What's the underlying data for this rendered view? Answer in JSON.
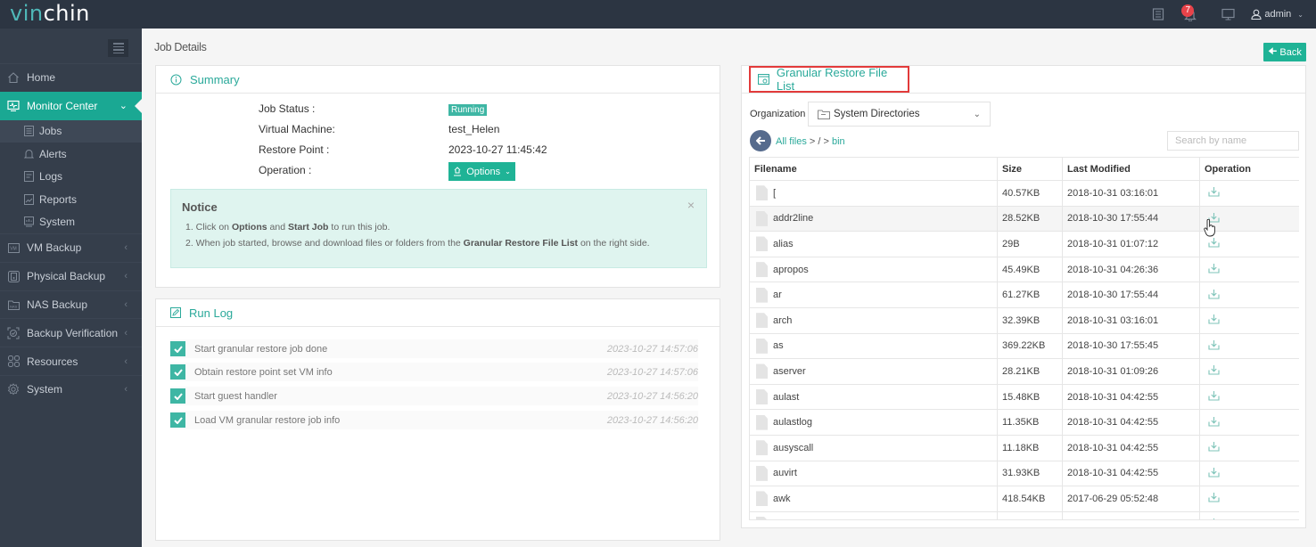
{
  "brand": {
    "part1": "vin",
    "part2": "chin"
  },
  "topbar": {
    "notification_count": "7",
    "user": "admin",
    "icons": [
      "task-list-icon",
      "bell-icon",
      "monitor-icon",
      "user-icon"
    ]
  },
  "sidebar": {
    "items": [
      {
        "label": "Home",
        "icon": "home-icon",
        "active": false
      },
      {
        "label": "Monitor Center",
        "icon": "monitor-center-icon",
        "active": true,
        "expanded": true
      },
      {
        "label": "VM Backup",
        "icon": "vm-icon"
      },
      {
        "label": "Physical Backup",
        "icon": "physical-icon"
      },
      {
        "label": "NAS Backup",
        "icon": "nas-icon"
      },
      {
        "label": "Backup Verification",
        "icon": "verification-icon"
      },
      {
        "label": "Resources",
        "icon": "resources-icon"
      },
      {
        "label": "System",
        "icon": "gear-icon"
      }
    ],
    "sub_items": [
      {
        "label": "Jobs",
        "active": true
      },
      {
        "label": "Alerts"
      },
      {
        "label": "Logs"
      },
      {
        "label": "Reports"
      },
      {
        "label": "System"
      }
    ]
  },
  "page": {
    "title": "Job Details",
    "back_label": "Back"
  },
  "summary": {
    "title": "Summary",
    "fields": [
      {
        "label": "Job Status :",
        "value": "Running"
      },
      {
        "label": "Virtual Machine:",
        "value": "test_Helen"
      },
      {
        "label": "Restore Point :",
        "value": "2023-10-27 11:45:42"
      },
      {
        "label": "Operation :",
        "value": "Options"
      }
    ],
    "notice": {
      "title": "Notice",
      "line1_a": "1. Click on ",
      "line1_b": "Options",
      "line1_c": " and ",
      "line1_d": "Start Job",
      "line1_e": " to run this job.",
      "line2_a": "2. When job started, browse and download files or folders from the ",
      "line2_b": "Granular Restore File List",
      "line2_c": " on the right side."
    }
  },
  "runlog": {
    "title": "Run Log",
    "entries": [
      {
        "text": "Start granular restore job done",
        "time": "2023-10-27 14:57:06"
      },
      {
        "text": "Obtain restore point set VM info",
        "time": "2023-10-27 14:57:06"
      },
      {
        "text": "Start guest handler",
        "time": "2023-10-27 14:56:20"
      },
      {
        "text": "Load VM granular restore job info",
        "time": "2023-10-27 14:56:20"
      }
    ]
  },
  "filelist": {
    "title": "Granular Restore File List",
    "organization_label": "Organization",
    "organization_value": "System Directories",
    "breadcrumb": {
      "root": "All files",
      "sep1": " > / > ",
      "current": "bin"
    },
    "search_placeholder": "Search by name",
    "columns": [
      "Filename",
      "Size",
      "Last Modified",
      "Operation"
    ],
    "rows": [
      {
        "name": "[",
        "size": "40.57KB",
        "modified": "2018-10-31 03:16:01"
      },
      {
        "name": "addr2line",
        "size": "28.52KB",
        "modified": "2018-10-30 17:55:44"
      },
      {
        "name": "alias",
        "size": "29B",
        "modified": "2018-10-31 01:07:12"
      },
      {
        "name": "apropos",
        "size": "45.49KB",
        "modified": "2018-10-31 04:26:36"
      },
      {
        "name": "ar",
        "size": "61.27KB",
        "modified": "2018-10-30 17:55:44"
      },
      {
        "name": "arch",
        "size": "32.39KB",
        "modified": "2018-10-31 03:16:01"
      },
      {
        "name": "as",
        "size": "369.22KB",
        "modified": "2018-10-30 17:55:45"
      },
      {
        "name": "aserver",
        "size": "28.21KB",
        "modified": "2018-10-31 01:09:26"
      },
      {
        "name": "aulast",
        "size": "15.48KB",
        "modified": "2018-10-31 04:42:55"
      },
      {
        "name": "aulastlog",
        "size": "11.35KB",
        "modified": "2018-10-31 04:42:55"
      },
      {
        "name": "ausyscall",
        "size": "11.18KB",
        "modified": "2018-10-31 04:42:55"
      },
      {
        "name": "auvirt",
        "size": "31.93KB",
        "modified": "2018-10-31 04:42:55"
      },
      {
        "name": "awk",
        "size": "418.54KB",
        "modified": "2017-06-29 05:52:48"
      },
      {
        "name": "",
        "size": "",
        "modified": ""
      }
    ]
  },
  "colors": {
    "accent": "#1fb396",
    "sidebar": "#353e4b",
    "topbar": "#2c3542",
    "highlight_box": "#e23a3a"
  }
}
